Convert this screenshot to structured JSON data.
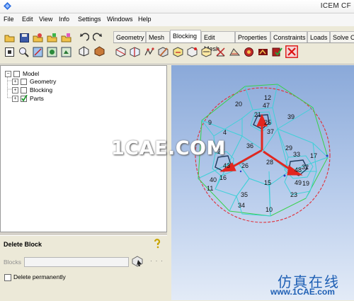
{
  "window": {
    "title": "ICEM CF"
  },
  "menu": [
    "File",
    "Edit",
    "View",
    "Info",
    "Settings",
    "Windows",
    "Help"
  ],
  "tabs": [
    "Geometry",
    "Mesh",
    "Blocking",
    "Edit Mesh",
    "Properties",
    "Constraints",
    "Loads",
    "Solve O"
  ],
  "active_tab": "Blocking",
  "tree": {
    "root": "Model",
    "children": [
      "Geometry",
      "Blocking",
      "Parts"
    ]
  },
  "panel": {
    "title": "Delete Block",
    "blocks_label": "Blocks",
    "blocks_value": "",
    "more_dots": "· · ·",
    "delete_permanently_label": "Delete permanently"
  },
  "viewport": {
    "block_numbers": [
      "12",
      "47",
      "20",
      "21",
      "25",
      "39",
      "9",
      "37",
      "4",
      "36",
      "29",
      "27",
      "33",
      "17",
      "43",
      "26",
      "28",
      "48",
      "32",
      "40",
      "16",
      "15",
      "49",
      "19",
      "11",
      "35",
      "23",
      "34",
      "10"
    ]
  },
  "watermark": {
    "main": "1CAE.COM",
    "chinese": "仿真在线",
    "url": "www.1CAE.com"
  },
  "colors": {
    "block_edges": "#3fd0d8",
    "curve_green": "#37d14a",
    "circle_red": "#e0303a",
    "arrow_red": "#e2261f",
    "brand_blue": "#1e5fb4"
  }
}
